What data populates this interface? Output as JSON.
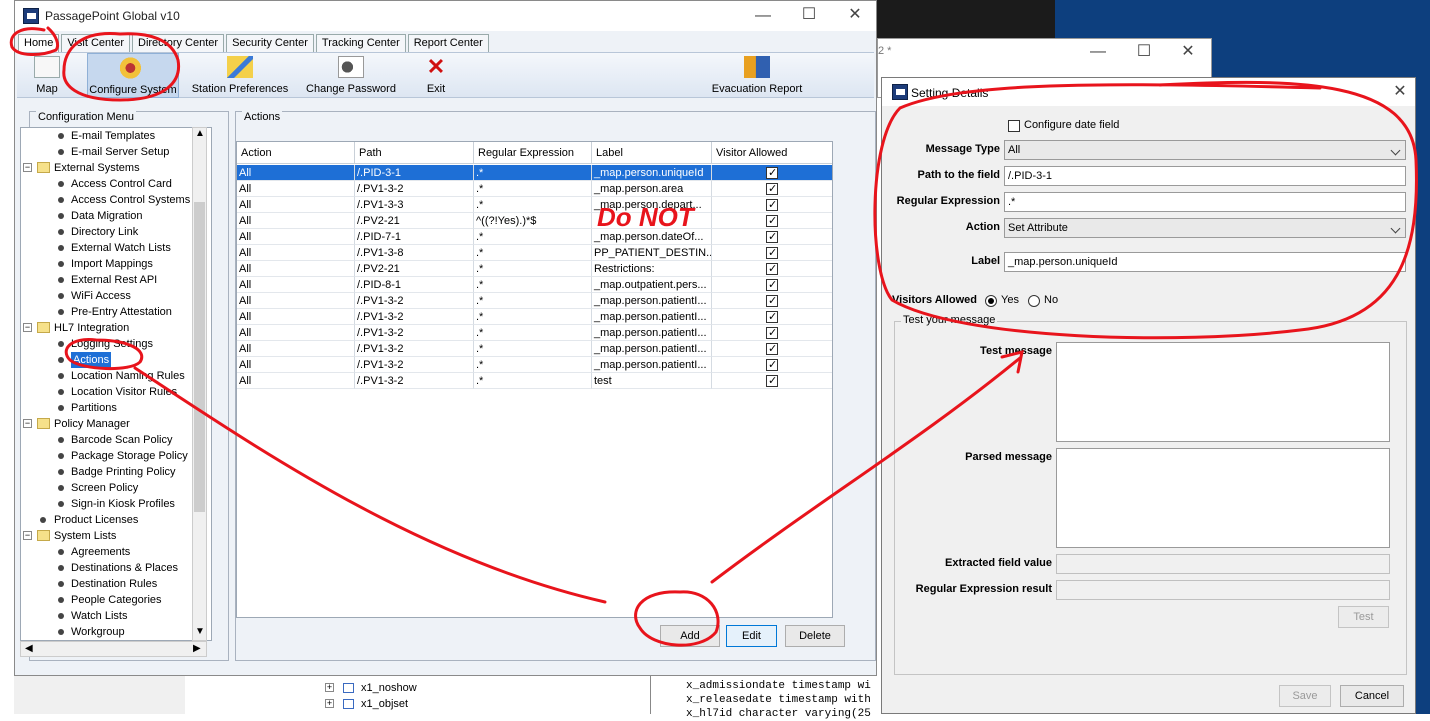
{
  "main_window": {
    "title": "PassagePoint Global v10",
    "menu_tabs": [
      "Home",
      "Visit Center",
      "Directory Center",
      "Security Center",
      "Tracking Center",
      "Report Center"
    ],
    "toolbar": {
      "map": "Map",
      "configure_system": "Configure System",
      "station_preferences": "Station Preferences",
      "change_password": "Change Password",
      "exit": "Exit",
      "evacuation_report": "Evacuation Report"
    },
    "config_menu": {
      "title": "Configuration Menu",
      "items": [
        {
          "label": "E-mail Templates",
          "level": 2
        },
        {
          "label": "E-mail Server Setup",
          "level": 2
        },
        {
          "label": "External Systems",
          "level": 1,
          "folder": true
        },
        {
          "label": "Access Control Card",
          "level": 2
        },
        {
          "label": "Access Control Systems",
          "level": 2
        },
        {
          "label": "Data Migration",
          "level": 2
        },
        {
          "label": "Directory Link",
          "level": 2
        },
        {
          "label": "External Watch Lists",
          "level": 2
        },
        {
          "label": "Import Mappings",
          "level": 2
        },
        {
          "label": "External Rest API",
          "level": 2
        },
        {
          "label": "WiFi Access",
          "level": 2
        },
        {
          "label": "Pre-Entry Attestation",
          "level": 2
        },
        {
          "label": "HL7 Integration",
          "level": 1,
          "folder": true
        },
        {
          "label": "Logging Settings",
          "level": 2
        },
        {
          "label": "Actions",
          "level": 2,
          "selected": true
        },
        {
          "label": "Location Naming Rules",
          "level": 2
        },
        {
          "label": "Location Visitor Rules",
          "level": 2
        },
        {
          "label": "Partitions",
          "level": 2
        },
        {
          "label": "Policy Manager",
          "level": 1,
          "folder": true
        },
        {
          "label": "Barcode Scan Policy",
          "level": 2
        },
        {
          "label": "Package Storage Policy",
          "level": 2
        },
        {
          "label": "Badge Printing Policy",
          "level": 2
        },
        {
          "label": "Screen Policy",
          "level": 2
        },
        {
          "label": "Sign-in Kiosk Profiles",
          "level": 2
        },
        {
          "label": "Product Licenses",
          "level": 1,
          "folder": false
        },
        {
          "label": "System Lists",
          "level": 1,
          "folder": true
        },
        {
          "label": "Agreements",
          "level": 2
        },
        {
          "label": "Destinations & Places",
          "level": 2
        },
        {
          "label": "Destination Rules",
          "level": 2
        },
        {
          "label": "People Categories",
          "level": 2
        },
        {
          "label": "Watch Lists",
          "level": 2
        },
        {
          "label": "Workgroup",
          "level": 2
        }
      ]
    },
    "actions_panel": {
      "title": "Actions",
      "columns": [
        "Action",
        "Path",
        "Regular Expression",
        "Label",
        "Visitor Allowed"
      ],
      "rows": [
        [
          "All",
          "/.PID-3-1",
          ".*",
          "_map.person.uniqueId",
          true
        ],
        [
          "All",
          "/.PV1-3-2",
          ".*",
          "_map.person.area",
          true
        ],
        [
          "All",
          "/.PV1-3-3",
          ".*",
          "_map.person.depart...",
          true
        ],
        [
          "All",
          "/.PV2-21",
          "^((?!Yes).)*$",
          "",
          true
        ],
        [
          "All",
          "/.PID-7-1",
          ".*",
          "_map.person.dateOf...",
          true
        ],
        [
          "All",
          "/.PV1-3-8",
          ".*",
          "PP_PATIENT_DESTIN...",
          true
        ],
        [
          "All",
          "/.PV2-21",
          ".*",
          "Restrictions:",
          true
        ],
        [
          "All",
          "/.PID-8-1",
          ".*",
          "_map.outpatient.pers...",
          true
        ],
        [
          "All",
          "/.PV1-3-2",
          ".*",
          "_map.person.patientI...",
          true
        ],
        [
          "All",
          "/.PV1-3-2",
          ".*",
          "_map.person.patientI...",
          true
        ],
        [
          "All",
          "/.PV1-3-2",
          ".*",
          "_map.person.patientI...",
          true
        ],
        [
          "All",
          "/.PV1-3-2",
          ".*",
          "_map.person.patientI...",
          true
        ],
        [
          "All",
          "/.PV1-3-2",
          ".*",
          "_map.person.patientI...",
          true
        ],
        [
          "All",
          "/.PV1-3-2",
          ".*",
          "test",
          true
        ]
      ],
      "overlay_text": "Do NOT",
      "buttons": {
        "add": "Add",
        "edit": "Edit",
        "delete": "Delete"
      }
    }
  },
  "background": {
    "window_title_fragment": "2 *",
    "tree_items": [
      "x1_noshow",
      "x1_objset"
    ],
    "code_lines": [
      "x_admissiondate timestamp wi",
      "x_releasedate timestamp with",
      "x_hl7id character varying(25"
    ]
  },
  "setting_dialog": {
    "title": "Setting Details",
    "configure_date_field": "Configure date field",
    "message_type_label": "Message Type",
    "message_type_value": "All",
    "path_label": "Path to the field",
    "path_value": "/.PID-3-1",
    "regex_label": "Regular Expression",
    "regex_value": ".*",
    "action_label": "Action",
    "action_value": "Set Attribute",
    "label_label": "Label",
    "label_value": "_map.person.uniqueId",
    "visitors_allowed_label": "Visitors Allowed",
    "yes": "Yes",
    "no": "No",
    "visitors_allowed_selected": "Yes",
    "test_group_title": "Test your message",
    "test_message_label": "Test message",
    "parsed_message_label": "Parsed message",
    "extracted_label": "Extracted field value",
    "regex_result_label": "Regular Expression result",
    "test_button": "Test",
    "save_button": "Save",
    "cancel_button": "Cancel"
  },
  "colors": {
    "selection": "#1e6fd6",
    "annotation": "#e8141c",
    "desktop": "#0d3f7e"
  }
}
